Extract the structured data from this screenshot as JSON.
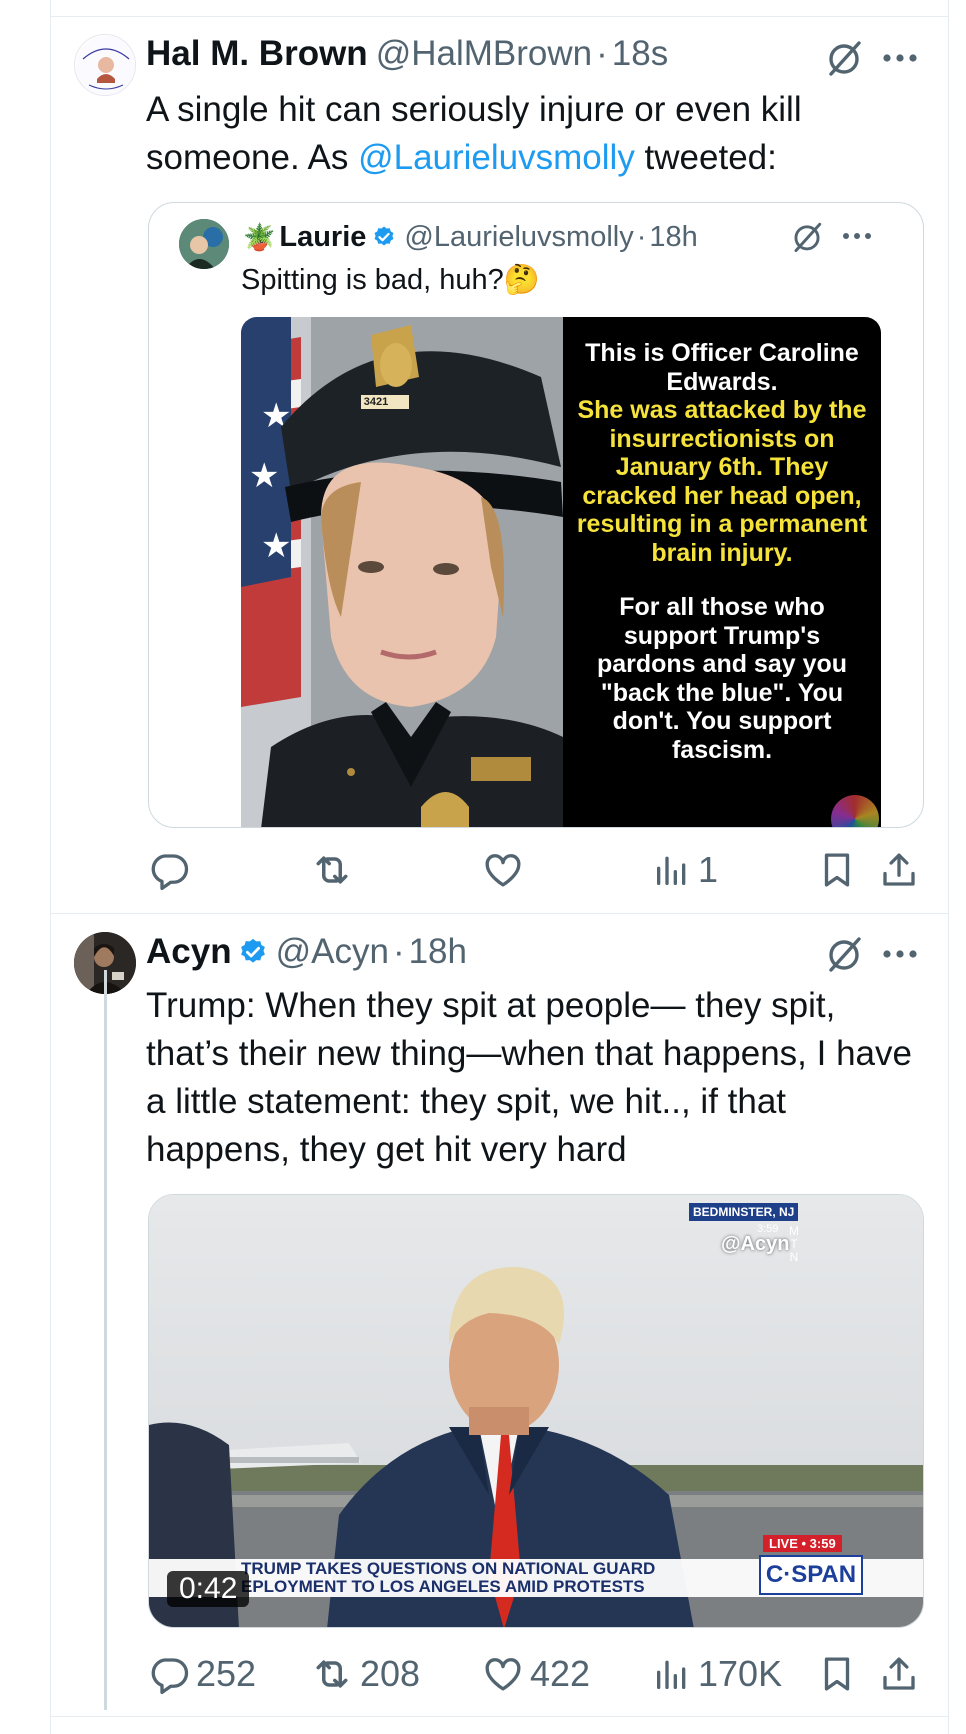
{
  "tweet1": {
    "author_name": "Hal M. Brown",
    "handle": "@HalMBrown",
    "separator": "·",
    "time": "18s",
    "text_before": "A single hit can seriously injure or even kill someone. As ",
    "mention": "@Laurieluvsmolly",
    "text_after": " tweeted:",
    "quote": {
      "author_name": "Laurie",
      "handle": "@Laurieluvsmolly",
      "separator": "·",
      "time": "18h",
      "text": "Spitting is bad, huh?🤔",
      "image": {
        "badge_number": "3421",
        "caption_white_1": "This is Officer Caroline Edwards.",
        "caption_yellow": "She was attacked by the insurrectionists on January 6th. They cracked her head open, resulting in a permanent brain injury.",
        "caption_white_2": "For all those who support Trump's pardons and say you \"back the blue\". You don't. You support fascism."
      }
    },
    "actions": {
      "replies": "",
      "reposts": "",
      "likes": "",
      "views": "1"
    }
  },
  "tweet2": {
    "author_name": "Acyn",
    "handle": "@Acyn",
    "separator": "·",
    "time": "18h",
    "text": "Trump: When they spit at people— they spit, that’s their new thing—when that happens, I have a little statement: they spit, we hit.., if that happens, they get hit very hard",
    "video": {
      "location_tag": "BEDMINSTER, NJ",
      "clock": "3:59",
      "watermark": "@Acyn",
      "watermark_side": "M T N",
      "live_tag": "LIVE • 3:59",
      "network": "C·SPAN",
      "chyron_line1": "TRUMP TAKES QUESTIONS ON NATIONAL GUARD",
      "chyron_line2": "EPLOYMENT TO LOS ANGELES AMID PROTESTS",
      "duration": "0:42"
    },
    "actions": {
      "replies": "252",
      "reposts": "208",
      "likes": "422",
      "views": "170K"
    }
  },
  "colors": {
    "link": "#1d9bf0",
    "verified": "#1d9bf0",
    "secondary": "#536471",
    "border": "#e6ecf0"
  },
  "icons": [
    "grok-icon",
    "more-icon",
    "reply-icon",
    "repost-icon",
    "like-icon",
    "views-icon",
    "bookmark-icon",
    "share-icon",
    "verified-badge-icon"
  ]
}
